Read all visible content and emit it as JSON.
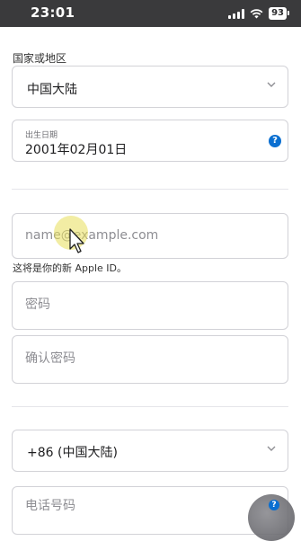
{
  "status_bar": {
    "time": "23:01",
    "battery": "93",
    "icons": [
      "signal-icon",
      "wifi-icon",
      "battery-icon"
    ]
  },
  "form": {
    "region_label": "国家或地区",
    "region_value": "中国大陆",
    "dob_label": "出生日期",
    "dob_value": "2001年02月01日",
    "email_placeholder": "name@example.com",
    "email_hint": "这将是你的新 Apple ID。",
    "password_placeholder": "密码",
    "confirm_password_placeholder": "确认密码",
    "country_code_value": "+86 (中国大陆)",
    "phone_placeholder": "电话号码"
  },
  "colors": {
    "accent": "#0a6fd1",
    "border": "#d2d2d7",
    "status_bar": "#3a3a3c"
  }
}
